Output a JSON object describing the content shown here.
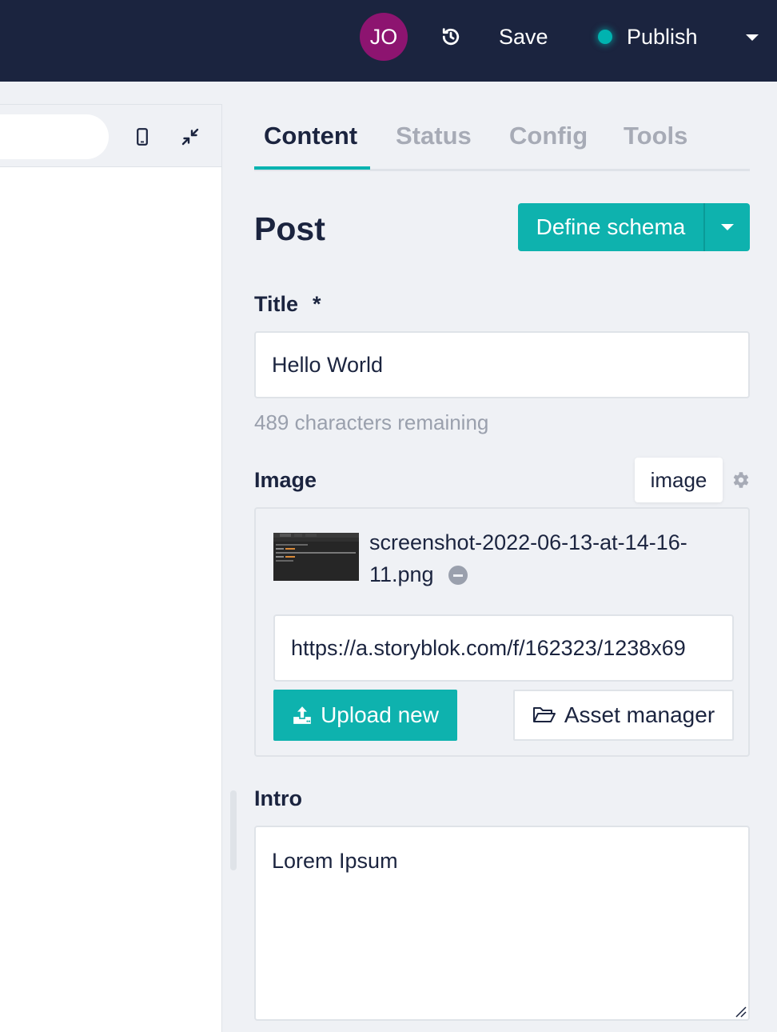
{
  "topbar": {
    "avatar_initials": "JO",
    "history_icon": "history-icon",
    "save_label": "Save",
    "publish_label": "Publish",
    "publish_status_color": "#00b3b0"
  },
  "preview": {
    "mobile_icon": "mobile-device-icon",
    "collapse_icon": "collapse-arrows-icon"
  },
  "tabs": [
    {
      "label": "Content",
      "active": true
    },
    {
      "label": "Status",
      "active": false
    },
    {
      "label": "Config",
      "active": false
    },
    {
      "label": "Tools",
      "active": false
    }
  ],
  "content": {
    "heading": "Post",
    "define_schema_label": "Define schema",
    "fields": {
      "title": {
        "label": "Title",
        "required_mark": "*",
        "value": "Hello World",
        "helper": "489 characters remaining"
      },
      "image": {
        "label": "Image",
        "tooltip": "image",
        "filename": "screenshot-2022-06-13-at-14-16-11.png",
        "url": "https://a.storyblok.com/f/162323/1238x69",
        "upload_label": "Upload new",
        "asset_manager_label": "Asset manager"
      },
      "intro": {
        "label": "Intro",
        "value": "Lorem Ipsum"
      }
    }
  },
  "colors": {
    "accent": "#00b3b0",
    "navy": "#1b243f",
    "avatar": "#8d1470"
  }
}
